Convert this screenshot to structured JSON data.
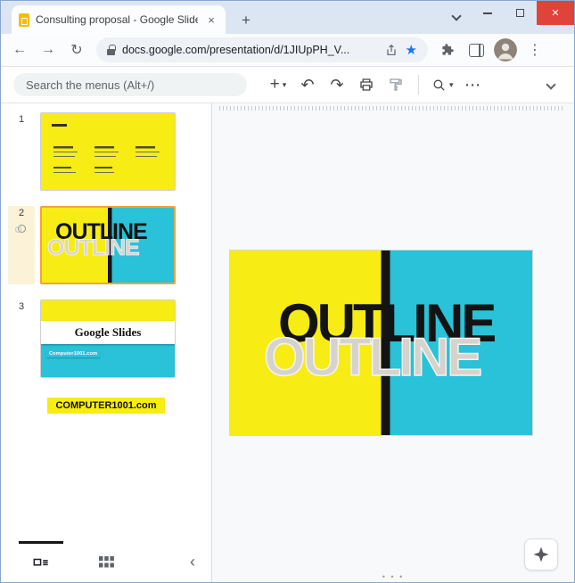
{
  "window": {
    "tab_title": "Consulting proposal - Google Slides"
  },
  "browser": {
    "url": "docs.google.com/presentation/d/1JIUpPH_V..."
  },
  "menus": {
    "search_placeholder": "Search the menus (Alt+/)"
  },
  "filmstrip": {
    "slides": [
      {
        "number": "1"
      },
      {
        "number": "2",
        "text_black": "OUTLINE",
        "text_gray": "OUTLINE",
        "selected": true
      },
      {
        "number": "3",
        "banner_text": "Google Slides",
        "badge_text": "Computer1001.com"
      }
    ],
    "caption": "COMPUTER1001.com"
  },
  "canvas": {
    "text_black": "OUTLINE",
    "text_gray": "OUTLINE"
  },
  "icons": {
    "slides_favicon": "css-yellow-document",
    "tab_close": "×",
    "new_tab": "+",
    "tab_list_chevron": "css-chevron-down",
    "minimize": "css-bar",
    "maximize": "css-square",
    "window_close": "×",
    "back": "←",
    "forward": "→",
    "reload": "↻",
    "lock": "css-padlock",
    "share": "svg-box-arrow-up",
    "star": "★",
    "extensions_puzzle": "svg-puzzle",
    "side_panel": "css-split-square",
    "profile_avatar": "svg-person",
    "more_vertical": "⋮",
    "plus": "+",
    "caret_down": "▾",
    "undo": "↶",
    "redo": "↷",
    "print": "svg-printer",
    "paint_format": "svg-paint-roller",
    "zoom": "svg-magnifier",
    "more_horizontal": "⋯",
    "hide_menus_chevron": "css-chevron-down",
    "transition_indicator": "css-circles",
    "filmstrip_view": "svg-filmstrip",
    "grid_view": "svg-grid",
    "collapse_left": "‹",
    "explore": "css-four-point-star",
    "scroll_dots": "• • •"
  },
  "colors": {
    "slide-yellow": "#f7ec13",
    "slide-cyan": "#29c2d8",
    "stripe-black": "#141414",
    "selected-border": "#f2a33c",
    "bookmark-star": "#1a73e8",
    "close-red": "#e04339",
    "titlebar": "#dce6f3",
    "caption-bg": "#f7ec13"
  }
}
